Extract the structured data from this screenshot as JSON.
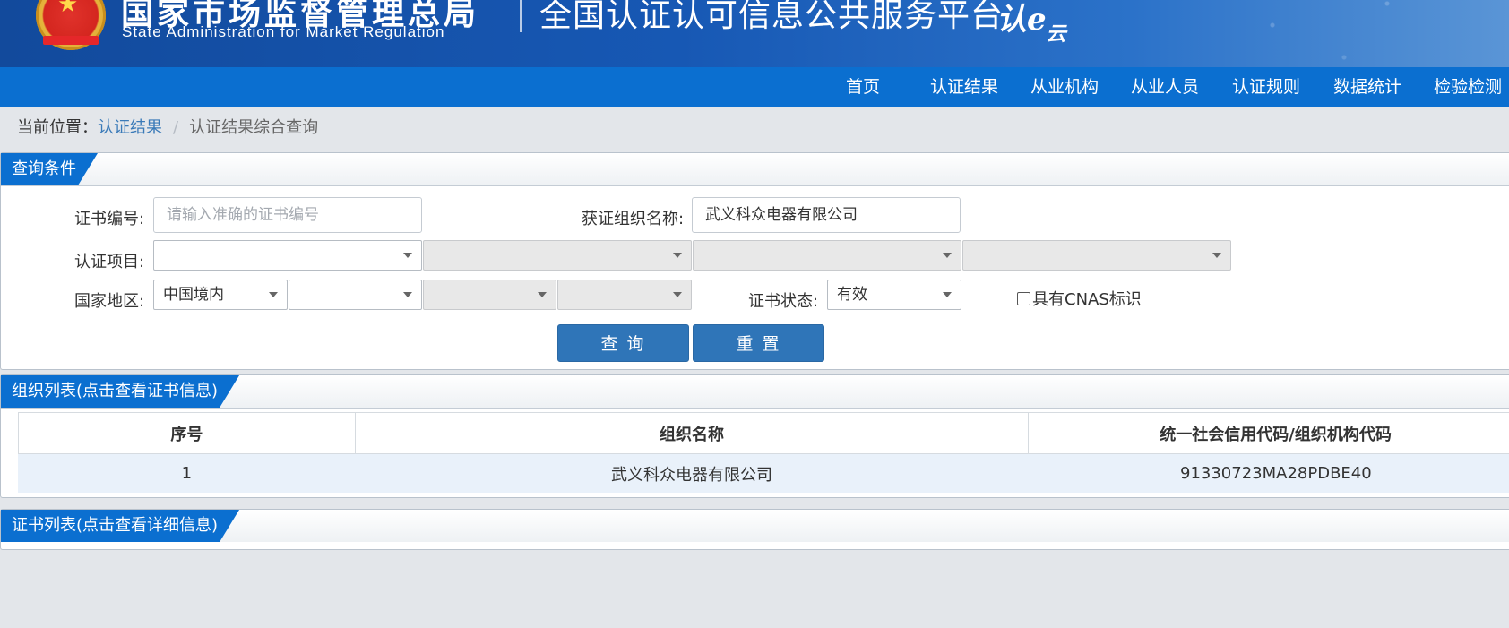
{
  "header": {
    "agency_cn": "国家市场监督管理总局",
    "agency_en": "State Administration  for  Market Regulation",
    "platform_title": "全国认证认可信息公共服务平台",
    "logo_text_a": "认e",
    "logo_text_b": "云"
  },
  "nav": {
    "items": [
      "首页",
      "认证结果",
      "从业机构",
      "从业人员",
      "认证规则",
      "数据统计",
      "检验检测"
    ]
  },
  "breadcrumb": {
    "prefix": "当前位置：",
    "link": "认证结果",
    "separator": "/",
    "current": "认证结果综合查询"
  },
  "query_panel": {
    "title": "查询条件",
    "cert_no_label": "证书编号:",
    "cert_no_placeholder": "请输入准确的证书编号",
    "org_name_label": "获证组织名称:",
    "org_name_value": "武义科众电器有限公司",
    "project_label": "认证项目:",
    "region_label": "国家地区:",
    "region_value": "中国境内",
    "status_label": "证书状态:",
    "status_value": "有效",
    "cnas_label": "具有CNAS标识",
    "cnas_checked": false,
    "search_button": "查 询",
    "reset_button": "重 置"
  },
  "org_panel": {
    "title": "组织列表(点击查看证书信息)",
    "columns": [
      "序号",
      "组织名称",
      "统一社会信用代码/组织机构代码"
    ],
    "rows": [
      [
        "1",
        "武义科众电器有限公司",
        "91330723MA28PDBE40"
      ]
    ]
  },
  "cert_panel": {
    "title": "证书列表(点击查看详细信息)"
  },
  "colors": {
    "nav_bg": "#0b6fd0",
    "banner_bg": "#1758b4",
    "button_bg": "#2f75b8",
    "row_highlight": "#e9f1fa",
    "page_bg": "#e3e6ea"
  }
}
